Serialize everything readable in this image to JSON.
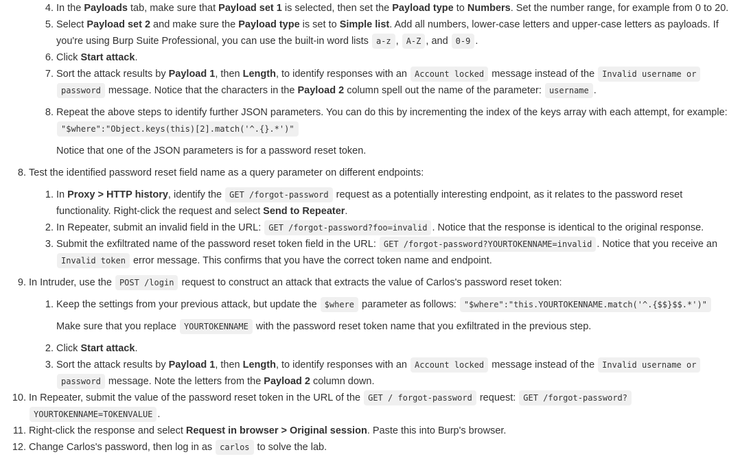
{
  "s7_items": [
    {
      "num": "4.",
      "parts": [
        "In the ",
        "Payloads",
        " tab, make sure that ",
        "Payload set 1",
        " is selected, then set the ",
        "Payload type",
        " to ",
        "Numbers",
        ". Set the number range, for example from 0 to 20."
      ]
    },
    {
      "num": "5.",
      "parts": [
        "Select ",
        "Payload set 2",
        " and make sure the ",
        "Payload type",
        " is set to ",
        "Simple list",
        ". Add all numbers, lower-case letters and upper-case letters as payloads. If you're using Burp Suite Professional, you can use the built-in word lists ",
        "a-z",
        ", ",
        "A-Z",
        ", and ",
        "0-9",
        "."
      ]
    },
    {
      "num": "6.",
      "parts": [
        "Click ",
        "Start attack",
        "."
      ]
    },
    {
      "num": "7.",
      "parts": [
        "Sort the attack results by ",
        "Payload 1",
        ", then ",
        "Length",
        ", to identify responses with an ",
        "Account locked",
        " message instead of the ",
        "Invalid username or password",
        " message. Notice that the characters in the ",
        "Payload 2",
        " column spell out the name of the parameter: ",
        "username",
        "."
      ]
    },
    {
      "num": "8.",
      "parts": [
        "Repeat the above steps to identify further JSON parameters. You can do this by incrementing the index of the keys array with each attempt, for example: ",
        "\"$where\":\"Object.keys(this)[2].match('^.{}.*')\""
      ],
      "note": "Notice that one of the JSON parameters is for a password reset token."
    }
  ],
  "step8": {
    "num": "8.",
    "text": "Test the identified password reset field name as a query parameter on different endpoints:",
    "items": [
      {
        "num": "1.",
        "parts": [
          "In ",
          "Proxy > HTTP history",
          ", identify the ",
          "GET /forgot-password",
          " request as a potentially interesting endpoint, as it relates to the password reset functionality. Right-click the request and select ",
          "Send to Repeater",
          "."
        ]
      },
      {
        "num": "2.",
        "parts": [
          "In Repeater, submit an invalid field in the URL: ",
          "GET /forgot-password?foo=invalid",
          ". Notice that the response is identical to the original response."
        ]
      },
      {
        "num": "3.",
        "parts": [
          "Submit the exfiltrated name of the password reset token field in the URL: ",
          "GET /forgot-password?YOURTOKENNAME=invalid",
          ". Notice that you receive an ",
          "Invalid token",
          " error message. This confirms that you have the correct token name and endpoint."
        ]
      }
    ]
  },
  "step9": {
    "num": "9.",
    "parts": [
      "In Intruder, use the ",
      "POST /login",
      " request to construct an attack that extracts the value of Carlos's password reset token:"
    ],
    "items": [
      {
        "num": "1.",
        "parts": [
          "Keep the settings from your previous attack, but update the ",
          "$where",
          " parameter as follows: ",
          "\"$where\":\"this.YOURTOKENNAME.match('^.{$$}$$.*')\""
        ],
        "note_parts": [
          "Make sure that you replace ",
          "YOURTOKENNAME",
          " with the password reset token name that you exfiltrated in the previous step."
        ]
      },
      {
        "num": "2.",
        "parts": [
          "Click ",
          "Start attack",
          "."
        ]
      },
      {
        "num": "3.",
        "parts": [
          "Sort the attack results by ",
          "Payload 1",
          ", then ",
          "Length",
          ", to identify responses with an ",
          "Account locked",
          " message instead of the ",
          "Invalid username or password",
          " message. Note the letters from the ",
          "Payload 2",
          " column down."
        ]
      }
    ]
  },
  "step10": {
    "num": "10.",
    "parts": [
      "In Repeater, submit the value of the password reset token in the URL of the ",
      "GET / forgot-password",
      " request: ",
      "GET /forgot-password?YOURTOKENNAME=TOKENVALUE",
      "."
    ]
  },
  "step11": {
    "num": "11.",
    "parts": [
      "Right-click the response and select ",
      "Request in browser > Original session",
      ". Paste this into Burp's browser."
    ]
  },
  "step12": {
    "num": "12.",
    "parts": [
      "Change Carlos's password, then log in as ",
      "carlos",
      " to solve the lab."
    ]
  }
}
